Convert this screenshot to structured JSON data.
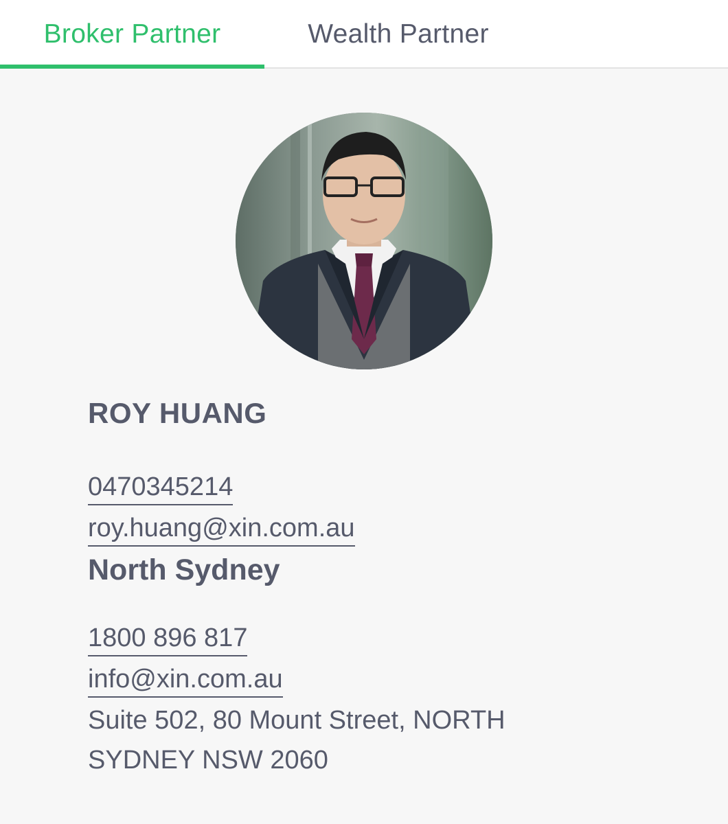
{
  "tabs": [
    {
      "label": "Broker Partner",
      "active": true
    },
    {
      "label": "Wealth Partner",
      "active": false
    }
  ],
  "colors": {
    "accent": "#2fbf6c",
    "text": "#565a6b",
    "background": "#f7f7f7"
  },
  "broker": {
    "name": "ROY HUANG",
    "phone": "0470345214",
    "email": "roy.huang@xin.com.au"
  },
  "office": {
    "name": "North Sydney",
    "phone": "1800 896 817",
    "email": "info@xin.com.au",
    "address": "Suite 502, 80 Mount Street, NORTH SYDNEY NSW 2060"
  }
}
